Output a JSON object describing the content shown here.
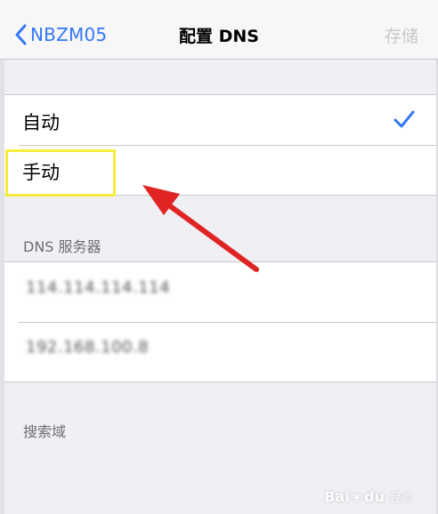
{
  "nav": {
    "back_label": "NBZM05",
    "title": "配置 DNS",
    "save_label": "存储"
  },
  "mode_options": [
    {
      "label": "自动",
      "selected": true
    },
    {
      "label": "手动",
      "selected": false
    }
  ],
  "dns_section": {
    "header": "DNS 服务器",
    "servers": [
      "114.114.114.114",
      "192.168.100.8"
    ]
  },
  "search_domain_section": {
    "header": "搜索域"
  },
  "watermark": {
    "brand": "Bai",
    "brand2": "du",
    "sub": "经验"
  },
  "colors": {
    "accent": "#3478f6",
    "highlight": "#f2ee3a",
    "arrow": "#e02424"
  }
}
